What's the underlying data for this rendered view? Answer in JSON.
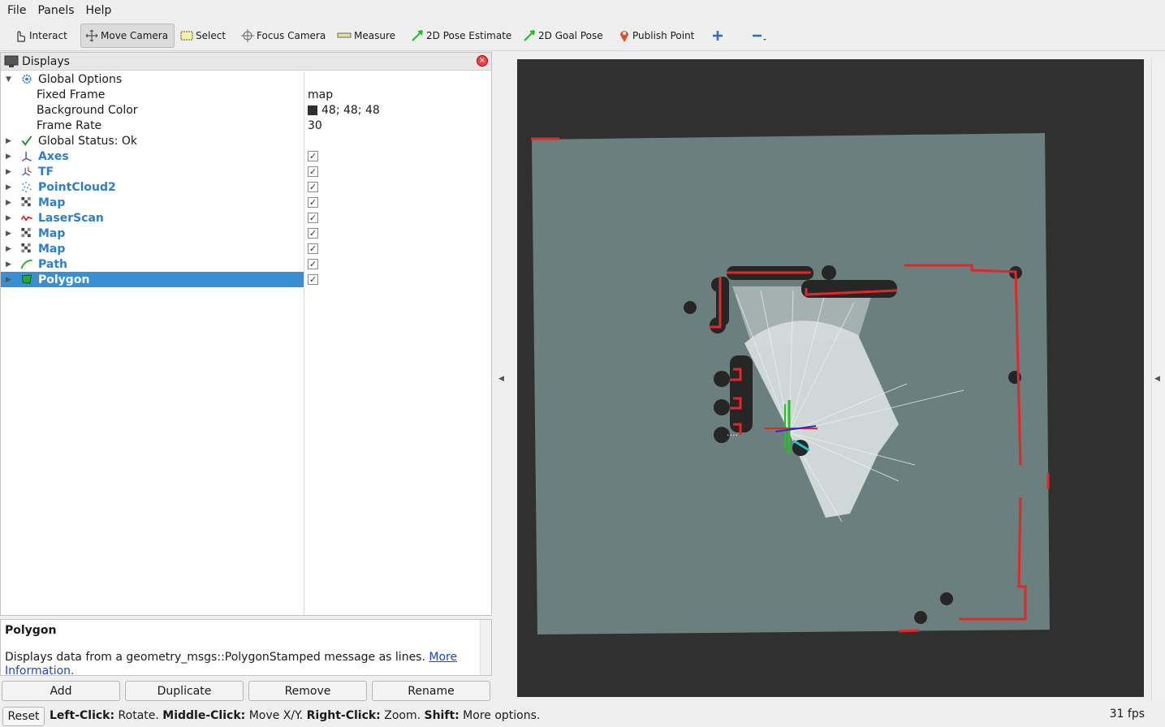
{
  "menu": {
    "file": "File",
    "panels": "Panels",
    "help": "Help"
  },
  "toolbar": {
    "interact": "Interact",
    "move_camera": "Move Camera",
    "select": "Select",
    "focus_camera": "Focus Camera",
    "measure": "Measure",
    "pose_estimate": "2D Pose Estimate",
    "goal_pose": "2D Goal Pose",
    "publish_point": "Publish Point"
  },
  "displays": {
    "title": "Displays",
    "global_options": "Global Options",
    "fixed_frame_label": "Fixed Frame",
    "fixed_frame_value": "map",
    "bg_color_label": "Background Color",
    "bg_color_value": "48; 48; 48",
    "frame_rate_label": "Frame Rate",
    "frame_rate_value": "30",
    "global_status": "Global Status: Ok",
    "items": [
      {
        "label": "Axes",
        "checked": true
      },
      {
        "label": "TF",
        "checked": true
      },
      {
        "label": "PointCloud2",
        "checked": true
      },
      {
        "label": "Map",
        "checked": true
      },
      {
        "label": "LaserScan",
        "checked": true
      },
      {
        "label": "Map",
        "checked": true
      },
      {
        "label": "Map",
        "checked": true
      },
      {
        "label": "Path",
        "checked": true
      },
      {
        "label": "Polygon",
        "checked": true,
        "selected": true
      }
    ]
  },
  "description": {
    "title": "Polygon",
    "text": "Displays data from a geometry_msgs::PolygonStamped message as lines.",
    "link": "More Information."
  },
  "buttons": {
    "add": "Add",
    "duplicate": "Duplicate",
    "remove": "Remove",
    "rename": "Rename"
  },
  "status": {
    "reset": "Reset",
    "hint_left": "Left-Click:",
    "hint_left_t": " Rotate. ",
    "hint_mid": "Middle-Click:",
    "hint_mid_t": " Move X/Y. ",
    "hint_right": "Right-Click:",
    "hint_right_t": " Zoom. ",
    "hint_shift": "Shift:",
    "hint_shift_t": " More options.",
    "fps": "31 fps"
  },
  "colors": {
    "background": "#303030",
    "map_free": "#6b7f7e",
    "laser": "#e02828",
    "selection": "#3a8fd3"
  }
}
